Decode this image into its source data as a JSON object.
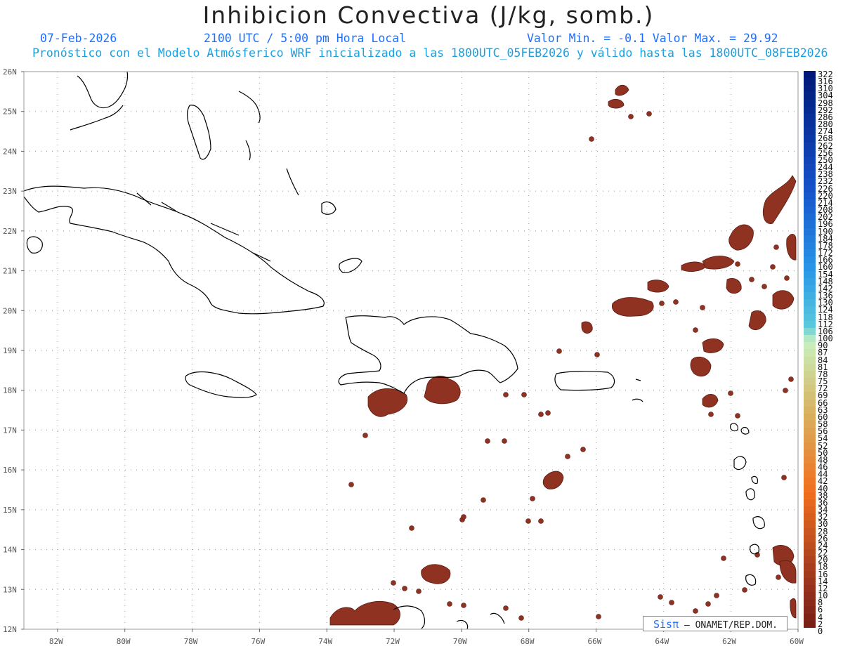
{
  "title": "Inhibicion Convectiva (J/kg, somb.)",
  "header": {
    "date": "07-Feb-2026",
    "time": "2100 UTC / 5:00 pm Hora Local",
    "min_max": "Valor Min. = -0.1  Valor Max. = 29.92",
    "model_info": "Pronóstico con el Modelo Atmósferico WRF inicializado a las 1800UTC_05FEB2026 y válido hasta las  1800UTC_08FEB2026"
  },
  "map": {
    "lat_labels": [
      "26N",
      "25N",
      "24N",
      "23N",
      "22N",
      "21N",
      "20N",
      "19N",
      "18N",
      "17N",
      "16N",
      "15N",
      "14N",
      "13N",
      "12N"
    ],
    "lon_labels": [
      "82W",
      "80W",
      "78W",
      "76W",
      "74W",
      "72W",
      "70W",
      "68W",
      "66W",
      "64W",
      "62W",
      "60W"
    ],
    "field_color": "#8f3222",
    "coast_color": "#000000",
    "grid_color": "#9a9a9a"
  },
  "colorbar": {
    "labels": [
      "322",
      "316",
      "310",
      "304",
      "298",
      "292",
      "286",
      "280",
      "274",
      "268",
      "262",
      "256",
      "250",
      "244",
      "238",
      "232",
      "226",
      "220",
      "214",
      "208",
      "202",
      "196",
      "190",
      "184",
      "178",
      "172",
      "166",
      "160",
      "154",
      "148",
      "142",
      "136",
      "130",
      "124",
      "118",
      "112",
      "106",
      "100",
      "90",
      "87",
      "84",
      "81",
      "78",
      "75",
      "72",
      "69",
      "66",
      "63",
      "60",
      "58",
      "56",
      "54",
      "52",
      "50",
      "48",
      "46",
      "44",
      "42",
      "40",
      "38",
      "36",
      "34",
      "32",
      "30",
      "28",
      "26",
      "24",
      "22",
      "20",
      "18",
      "16",
      "14",
      "12",
      "10",
      "8",
      "6",
      "4",
      "2",
      "0"
    ]
  },
  "credit": {
    "brand": "Sisπ",
    "org": " – ONAMET/REP.DOM."
  }
}
